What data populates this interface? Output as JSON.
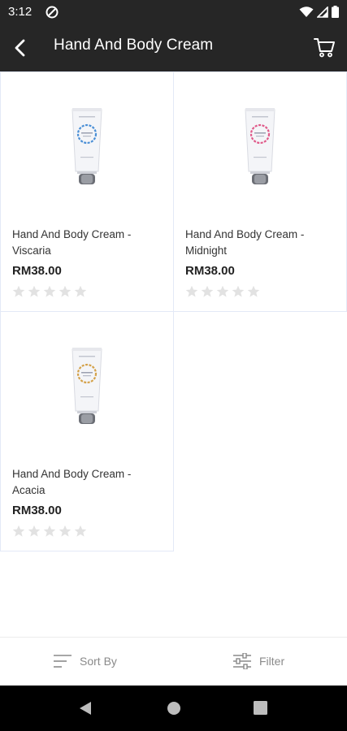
{
  "status": {
    "time": "3:12"
  },
  "appbar": {
    "title": "Hand And Body Cream"
  },
  "products": [
    {
      "name": "Hand And Body Cream - Viscaria",
      "price": "RM38.00",
      "rating": 0,
      "accent": "#4a8fd6"
    },
    {
      "name": "Hand And Body Cream - Midnight",
      "price": "RM38.00",
      "rating": 0,
      "accent": "#e05a8a"
    },
    {
      "name": "Hand And Body Cream - Acacia",
      "price": "RM38.00",
      "rating": 0,
      "accent": "#d4a24a"
    }
  ],
  "bottombar": {
    "sort_label": "Sort By",
    "filter_label": "Filter"
  },
  "colors": {
    "bar": "#262626",
    "card_border": "#e3e9f7",
    "star_empty": "#e2e2e2"
  }
}
